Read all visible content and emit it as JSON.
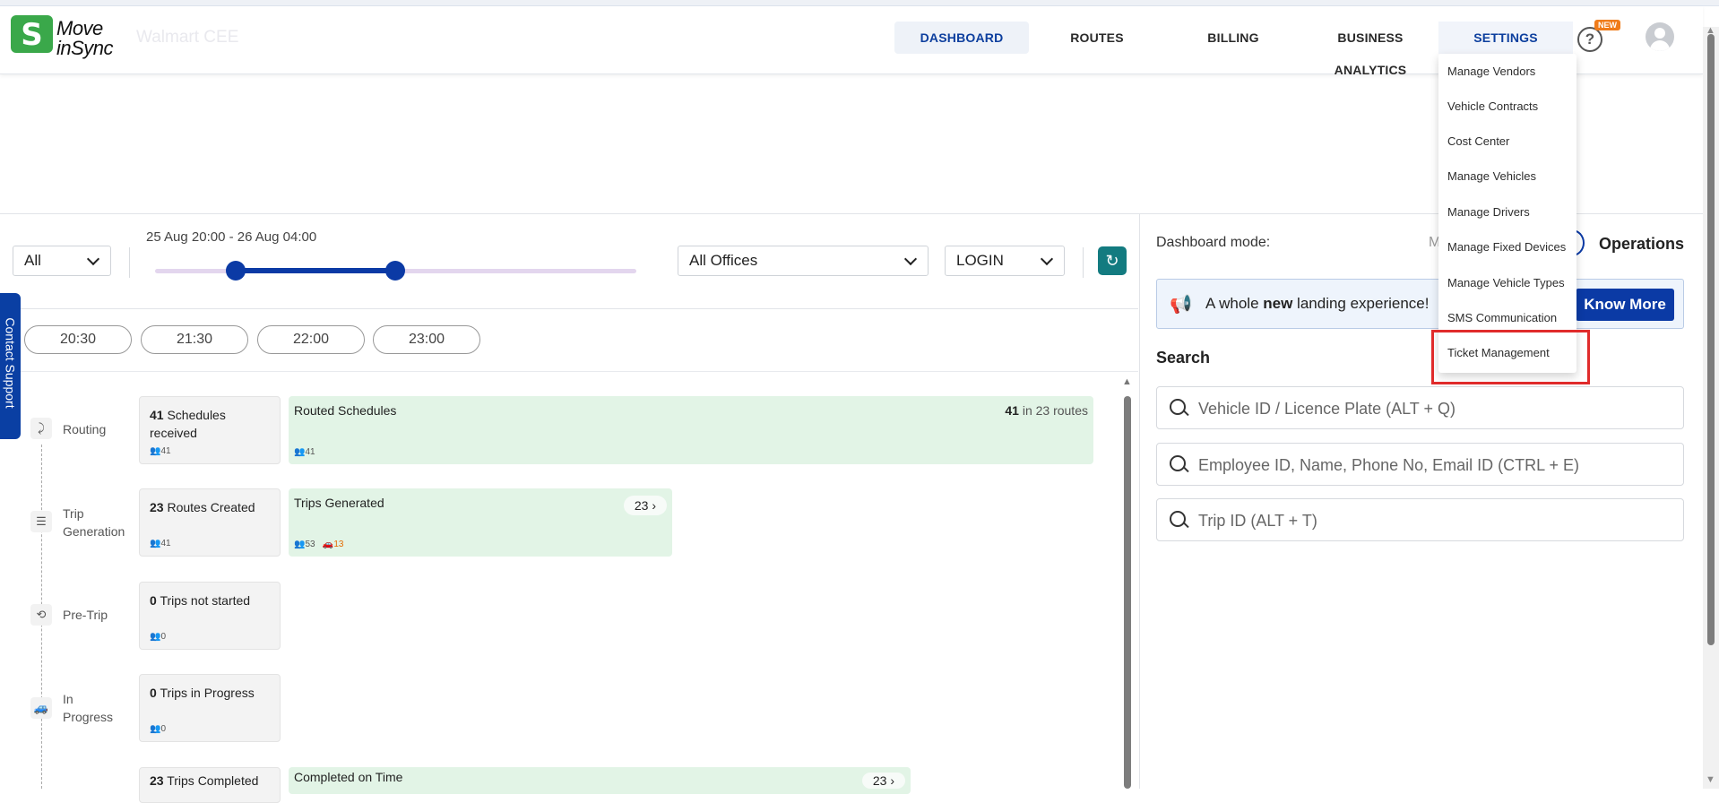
{
  "header": {
    "logo_top": "Move",
    "logo_bottom": "inSync",
    "logo_mark": "S",
    "company": "Walmart CEE",
    "nav": [
      "DASHBOARD",
      "ROUTES",
      "BILLING",
      "BUSINESS ANALYTICS",
      "SETTINGS"
    ],
    "help": "?",
    "new_badge": "NEW"
  },
  "settings_menu": {
    "items": [
      "Manage Vendors",
      "Vehicle Contracts",
      "Cost Center",
      "Manage Vehicles",
      "Manage Drivers",
      "Manage Fixed Devices",
      "Manage Vehicle Types",
      "SMS Communication",
      "Ticket Management"
    ],
    "highlighted": "Ticket Management"
  },
  "filters": {
    "all": "All",
    "time_range": "25 Aug 20:00 - 26 Aug 04:00",
    "range_start_fraction": 0.17,
    "range_end_fraction": 0.5,
    "office": "All Offices",
    "direction": "LOGIN",
    "time_pills": [
      "20:30",
      "21:30",
      "22:00",
      "23:00"
    ]
  },
  "contact_support": "Contact Support",
  "stages": {
    "routing": {
      "label": "Routing",
      "card_count": "41",
      "card_text": "Schedules received",
      "card_people": "41",
      "green_title": "Routed Schedules",
      "green_count": "41",
      "green_suffix": "in 23 routes",
      "green_people": "41"
    },
    "trip_generation": {
      "label_line1": "Trip",
      "label_line2": "Generation",
      "card_count": "23",
      "card_text": "Routes Created",
      "card_people": "41",
      "green_title": "Trips Generated",
      "green_badge": "23",
      "green_people": "53",
      "green_vehicles": "13"
    },
    "pre_trip": {
      "label": "Pre-Trip",
      "card_count": "0",
      "card_text": "Trips not started",
      "card_people": "0"
    },
    "in_progress": {
      "label_line1": "In",
      "label_line2": "Progress",
      "card_count": "0",
      "card_text": "Trips in Progress",
      "card_people": "0"
    },
    "completed": {
      "card_count": "23",
      "card_text": "Trips Completed",
      "green_title": "Completed on Time",
      "green_badge": "23"
    }
  },
  "right_panel": {
    "dashboard_mode_label": "Dashboard mode:",
    "mode_partial": "M",
    "mode_active": "Operations",
    "banner_pre": "A whole ",
    "banner_bold": "new",
    "banner_post": " landing experience!",
    "know_more": "Know More",
    "search_title": "Search",
    "search_placeholders": [
      "Vehicle ID / Licence Plate (ALT + Q)",
      "Employee ID, Name, Phone No, Email ID (CTRL + E)",
      "Trip ID (ALT + T)"
    ]
  }
}
